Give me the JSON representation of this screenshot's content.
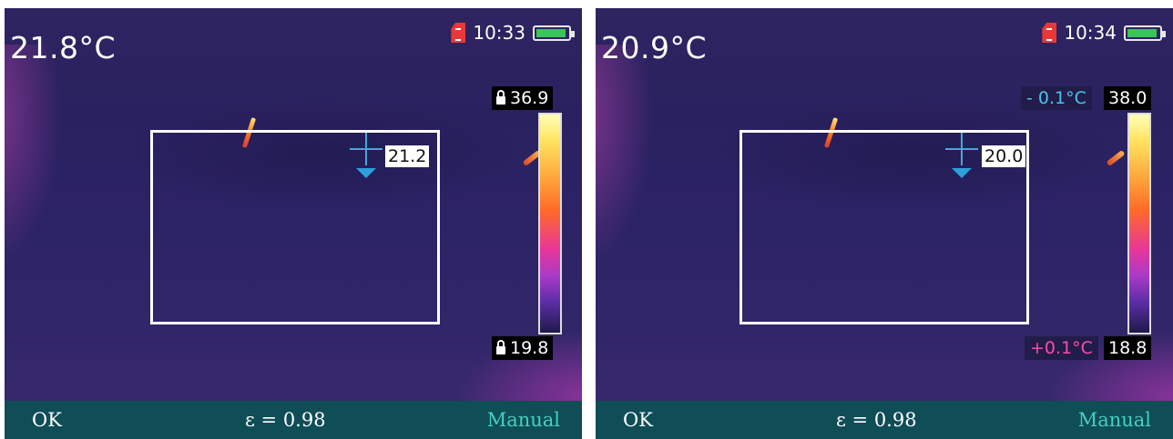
{
  "screens": [
    {
      "main_temp": "21.8°C",
      "time": "10:33",
      "spot_temp": "21.2",
      "scale_max": "36.9",
      "scale_min": "19.8",
      "softkeys": {
        "left": "OK",
        "center": "ε = 0.98",
        "right": "Manual"
      },
      "icons": [
        "sd-card-icon",
        "battery-icon",
        "lock-icon"
      ],
      "battery_level": 0.9
    },
    {
      "main_temp": "20.9°C",
      "time": "10:34",
      "spot_temp": "20.0",
      "scale_max": "38.0",
      "scale_min": "18.8",
      "offset_top": "- 0.1°C",
      "offset_bottom": "+0.1°C",
      "softkeys": {
        "left": "OK",
        "center": "ε = 0.98",
        "right": "Manual"
      },
      "icons": [
        "sd-card-icon",
        "battery-icon"
      ],
      "battery_level": 0.9
    }
  ],
  "colors": {
    "accent_cyan": "#4ac4e8",
    "accent_pink": "#ff4aa8",
    "softkey_bar": "#0f4d57",
    "mode_text": "#44d0c0",
    "battery_green": "#39c55a",
    "sd_red": "#e83838"
  }
}
